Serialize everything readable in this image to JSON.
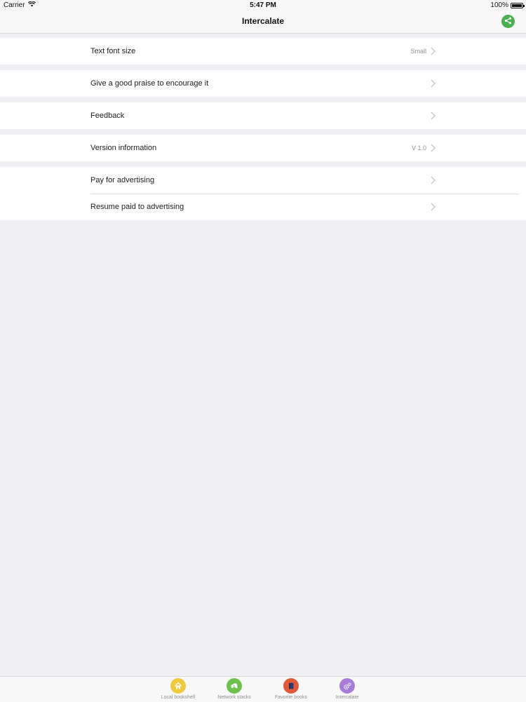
{
  "status_bar": {
    "carrier": "Carrier",
    "time": "5:47 PM",
    "battery": "100%"
  },
  "nav": {
    "title": "Intercalate"
  },
  "settings": {
    "font_size": {
      "label": "Text font size",
      "value": "Small"
    },
    "praise": {
      "label": "Give a good praise to encourage it"
    },
    "feedback": {
      "label": "Feedback"
    },
    "version": {
      "label": "Version information",
      "value": "V 1.0"
    },
    "pay_ads": {
      "label": "Pay for advertising"
    },
    "resume_ads": {
      "label": "Resume paid to advertising"
    }
  },
  "tabs": [
    {
      "label": "Local bookshelf",
      "icon": "house-icon",
      "color": "#f0c93e"
    },
    {
      "label": "Network stacks",
      "icon": "cloud-icon",
      "color": "#6cc24a"
    },
    {
      "label": "Favorite books",
      "icon": "book-icon",
      "color": "#e05a3a"
    },
    {
      "label": "Intercalate",
      "icon": "gear-icon",
      "color": "#a87dd8"
    }
  ],
  "colors": {
    "accent_green": "#4caf50",
    "background": "#efeff4"
  }
}
